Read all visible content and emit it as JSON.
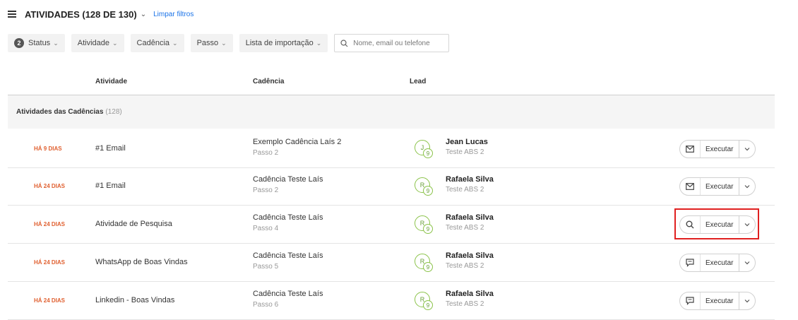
{
  "header": {
    "title": "ATIVIDADES (128 DE 130)",
    "clear_filters": "Limpar filtros"
  },
  "filters": {
    "status_count": "2",
    "status": "Status",
    "activity": "Atividade",
    "cadence": "Cadência",
    "step": "Passo",
    "import_list": "Lista de importação",
    "search_placeholder": "Nome, email ou telefone"
  },
  "columns": {
    "activity": "Atividade",
    "cadence": "Cadência",
    "lead": "Lead"
  },
  "group": {
    "title": "Atividades das Cadências",
    "count": "(128)"
  },
  "rows": [
    {
      "time": "HÁ 9 DIAS",
      "activity": "#1 Email",
      "cadence": "Exemplo Cadência Laís 2",
      "step": "Passo 2",
      "initial": "J",
      "score": "9",
      "lead_name": "Jean Lucas",
      "lead_company": "Teste ABS 2",
      "action_icon": "mail-icon",
      "action": "Executar"
    },
    {
      "time": "HÁ 24 DIAS",
      "activity": "#1 Email",
      "cadence": "Cadência Teste Laís",
      "step": "Passo 2",
      "initial": "R",
      "score": "9",
      "lead_name": "Rafaela Silva",
      "lead_company": "Teste ABS 2",
      "action_icon": "mail-icon",
      "action": "Executar"
    },
    {
      "time": "HÁ 24 DIAS",
      "activity": "Atividade de Pesquisa",
      "cadence": "Cadência Teste Laís",
      "step": "Passo 4",
      "initial": "R",
      "score": "9",
      "lead_name": "Rafaela Silva",
      "lead_company": "Teste ABS 2",
      "action_icon": "search-icon",
      "action": "Executar"
    },
    {
      "time": "HÁ 24 DIAS",
      "activity": "WhatsApp de Boas Vindas",
      "cadence": "Cadência Teste Laís",
      "step": "Passo 5",
      "initial": "R",
      "score": "9",
      "lead_name": "Rafaela Silva",
      "lead_company": "Teste ABS 2",
      "action_icon": "chat-icon",
      "action": "Executar"
    },
    {
      "time": "HÁ 24 DIAS",
      "activity": "Linkedin - Boas Vindas",
      "cadence": "Cadência Teste Laís",
      "step": "Passo 6",
      "initial": "R",
      "score": "9",
      "lead_name": "Rafaela Silva",
      "lead_company": "Teste ABS 2",
      "action_icon": "chat-icon",
      "action": "Executar"
    }
  ],
  "colors": {
    "time_text": "#e06030",
    "link": "#1a73e8",
    "avatar_border": "#8bc34a",
    "highlight_box": "#e02020"
  }
}
